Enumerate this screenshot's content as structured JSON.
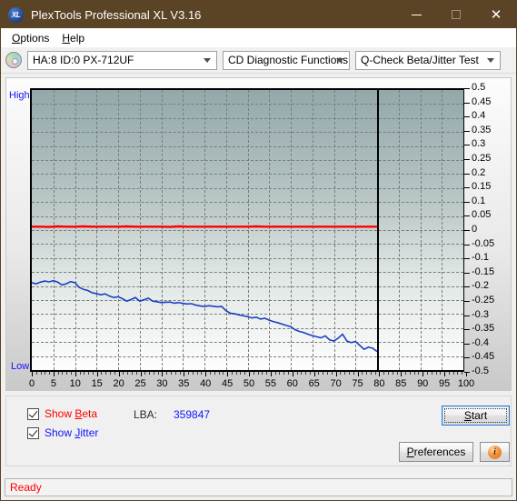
{
  "window": {
    "title": "PlexTools Professional XL V3.16",
    "app_icon": "xl-disc-icon",
    "minimize": "minimize-icon",
    "maximize": "maximize-icon",
    "close": "close-icon"
  },
  "menu": {
    "items": [
      {
        "label": "Options",
        "accel": "O"
      },
      {
        "label": "Help",
        "accel": "H"
      }
    ]
  },
  "toolbar": {
    "drive_icon": "disc-icon",
    "drive_combo": "HA:8 ID:0  PX-712UF",
    "function_combo": "CD Diagnostic Functions",
    "test_combo": "Q-Check Beta/Jitter Test"
  },
  "chart_data": {
    "type": "line",
    "title": "",
    "xlabel": "",
    "ylabel": "",
    "xlim": [
      0,
      100
    ],
    "ylim": [
      -0.5,
      0.5
    ],
    "grid": true,
    "left_axis_top_label": "High",
    "left_axis_bottom_label": "Low",
    "xticks": [
      0,
      5,
      10,
      15,
      20,
      25,
      30,
      35,
      40,
      45,
      50,
      55,
      60,
      65,
      70,
      75,
      80,
      85,
      90,
      95,
      100
    ],
    "yticks": [
      0.5,
      0.45,
      0.4,
      0.35,
      0.3,
      0.25,
      0.2,
      0.15,
      0.1,
      0.05,
      0,
      -0.05,
      -0.1,
      -0.15,
      -0.2,
      -0.25,
      -0.3,
      -0.35,
      -0.4,
      -0.45,
      -0.5
    ],
    "marker_x": 80,
    "series": [
      {
        "name": "Beta",
        "color": "#ff0000",
        "x": [
          0,
          2,
          4,
          6,
          8,
          10,
          12,
          14,
          16,
          18,
          20,
          22,
          24,
          26,
          28,
          30,
          32,
          34,
          36,
          38,
          40,
          42,
          44,
          46,
          48,
          50,
          52,
          54,
          56,
          58,
          60,
          62,
          64,
          66,
          68,
          70,
          72,
          74,
          76,
          78,
          80
        ],
        "values": [
          0.012,
          0.012,
          0.011,
          0.013,
          0.012,
          0.012,
          0.013,
          0.012,
          0.012,
          0.012,
          0.012,
          0.013,
          0.012,
          0.012,
          0.012,
          0.012,
          0.011,
          0.013,
          0.012,
          0.012,
          0.012,
          0.012,
          0.012,
          0.012,
          0.012,
          0.012,
          0.013,
          0.012,
          0.012,
          0.012,
          0.012,
          0.012,
          0.012,
          0.012,
          0.012,
          0.012,
          0.012,
          0.012,
          0.012,
          0.012,
          0.012
        ]
      },
      {
        "name": "Jitter",
        "color": "#1a3fc4",
        "x": [
          0,
          1,
          2,
          3,
          4,
          5,
          6,
          7,
          8,
          9,
          10,
          11,
          12,
          13,
          14,
          15,
          16,
          17,
          18,
          19,
          20,
          21,
          22,
          23,
          24,
          25,
          26,
          27,
          28,
          29,
          30,
          31,
          32,
          33,
          34,
          35,
          36,
          37,
          38,
          39,
          40,
          41,
          42,
          43,
          44,
          45,
          46,
          47,
          48,
          49,
          50,
          51,
          52,
          53,
          54,
          55,
          56,
          57,
          58,
          59,
          60,
          61,
          62,
          63,
          64,
          65,
          66,
          67,
          68,
          69,
          70,
          71,
          72,
          73,
          74,
          75,
          76,
          77,
          78,
          79,
          80
        ],
        "values": [
          -0.188,
          -0.192,
          -0.186,
          -0.182,
          -0.185,
          -0.181,
          -0.186,
          -0.196,
          -0.192,
          -0.184,
          -0.188,
          -0.205,
          -0.212,
          -0.216,
          -0.224,
          -0.227,
          -0.231,
          -0.228,
          -0.236,
          -0.241,
          -0.238,
          -0.245,
          -0.254,
          -0.248,
          -0.241,
          -0.254,
          -0.249,
          -0.243,
          -0.254,
          -0.256,
          -0.259,
          -0.258,
          -0.257,
          -0.261,
          -0.259,
          -0.262,
          -0.264,
          -0.263,
          -0.268,
          -0.271,
          -0.273,
          -0.27,
          -0.272,
          -0.274,
          -0.273,
          -0.288,
          -0.297,
          -0.299,
          -0.303,
          -0.306,
          -0.309,
          -0.314,
          -0.311,
          -0.318,
          -0.315,
          -0.322,
          -0.327,
          -0.331,
          -0.336,
          -0.341,
          -0.345,
          -0.356,
          -0.362,
          -0.366,
          -0.372,
          -0.377,
          -0.381,
          -0.385,
          -0.378,
          -0.392,
          -0.396,
          -0.386,
          -0.372,
          -0.396,
          -0.402,
          -0.398,
          -0.412,
          -0.426,
          -0.418,
          -0.422,
          -0.434
        ]
      }
    ]
  },
  "controls": {
    "show_beta_label": "Show Beta",
    "show_beta_accel": "B",
    "show_beta_checked": true,
    "show_jitter_label": "Show Jitter",
    "show_jitter_accel": "J",
    "show_jitter_checked": true,
    "lba_label": "LBA:",
    "lba_value": "359847",
    "start_label": "Start",
    "start_accel": "S",
    "preferences_label": "Preferences",
    "preferences_accel": "P",
    "info_icon": "info-icon",
    "info_glyph": "i"
  },
  "statusbar": {
    "text": "Ready"
  }
}
